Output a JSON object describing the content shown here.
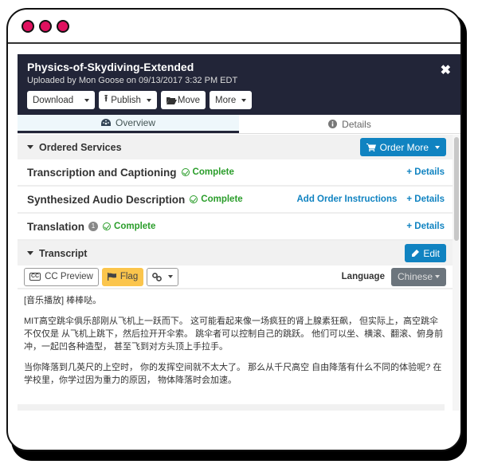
{
  "window": {
    "dots": [
      "close",
      "minimize",
      "maximize"
    ],
    "dot_color": "#e0115f"
  },
  "header": {
    "title": "Physics-of-Skydiving-Extended",
    "subtitle": "Uploaded by Mon Goose on 09/13/2017 3:32 PM EDT",
    "close_icon": "✖",
    "buttons": {
      "download": "Download",
      "publish": "Publish",
      "move": "Move",
      "more": "More"
    }
  },
  "tabs": {
    "overview": "Overview",
    "details": "Details"
  },
  "ordered_services": {
    "title": "Ordered Services",
    "order_more": "Order More",
    "services": [
      {
        "name": "Transcription and Captioning",
        "status": "Complete",
        "actions": [
          "+ Details"
        ]
      },
      {
        "name": "Synthesized Audio Description",
        "status": "Complete",
        "actions": [
          "Add Order Instructions",
          "+ Details"
        ]
      },
      {
        "name": "Translation",
        "badge": "1",
        "status": "Complete",
        "actions": [
          "+ Details"
        ]
      }
    ]
  },
  "transcript": {
    "title": "Transcript",
    "edit": "Edit",
    "cc_preview": "CC Preview",
    "flag": "Flag",
    "language_label": "Language",
    "language_value": "Chinese",
    "paragraphs": [
      "[音乐播放] 棒棒哒。",
      "MIT高空跳伞俱乐部刚从飞机上一跃而下。 这可能看起来像一场疯狂的肾上腺素狂飙， 但实际上，高空跳伞不仅仅是 从飞机上跳下，然后拉开开伞索。 跳伞者可以控制自己的跳跃。 他们可以坐、横滚、翻滚、俯身前冲，一起凹各种造型， 甚至飞到对方头顶上手拉手。",
      "当你降落到几英尺的上空时， 你的发挥空间就不太大了。 那么从千尺高空 自由降落有什么不同的体验呢? 在学校里，你学过因为重力的原因， 物体降落时会加速。"
    ]
  },
  "colors": {
    "header_bg": "#222538",
    "primary": "#1083c1",
    "success": "#2a9d2a",
    "flag": "#fbc54c",
    "secondary": "#6c757d"
  }
}
